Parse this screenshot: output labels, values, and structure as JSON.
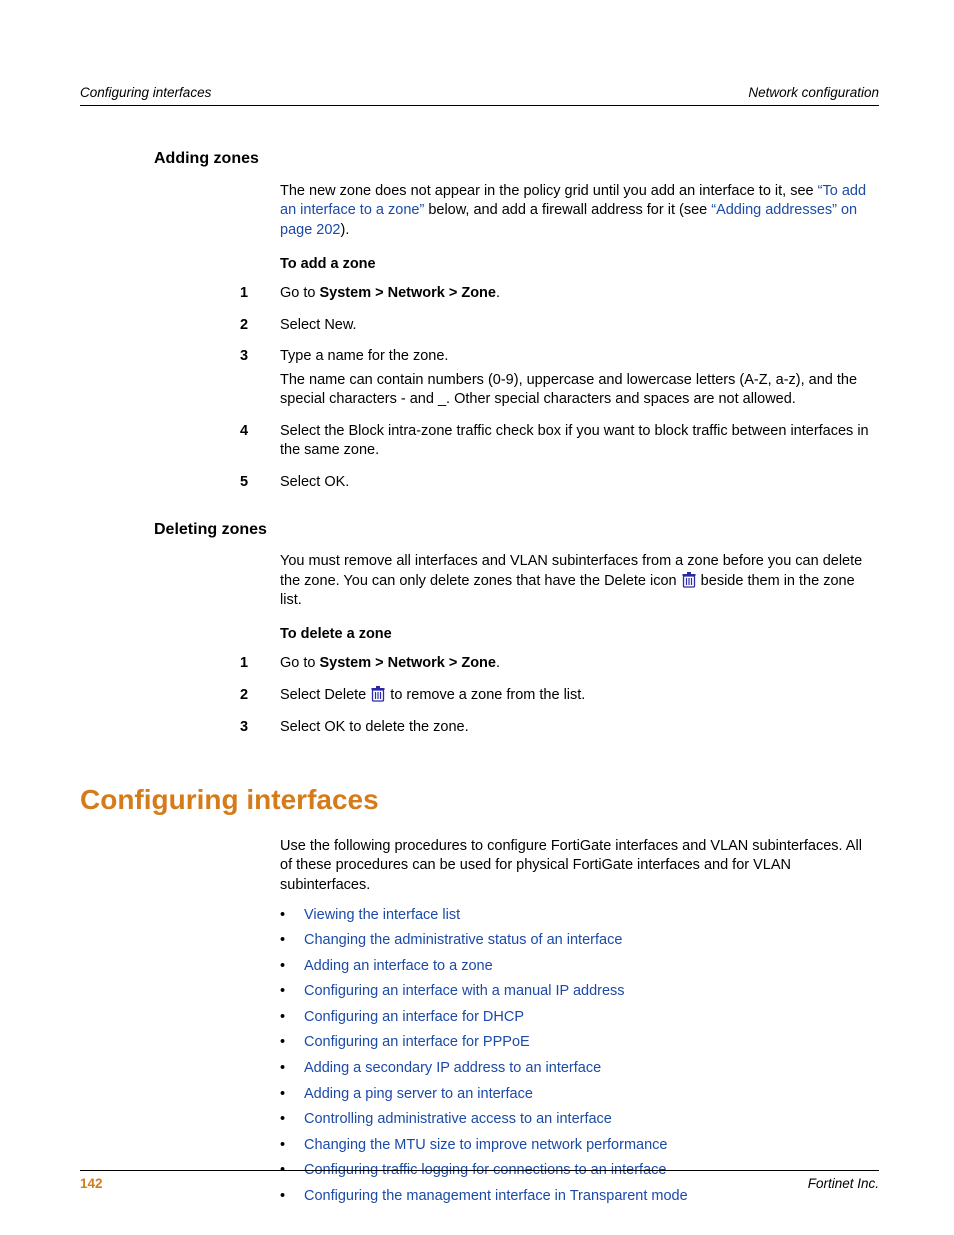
{
  "header": {
    "left": "Configuring interfaces",
    "right": "Network configuration"
  },
  "sections": {
    "addingZones": {
      "title": "Adding zones",
      "intro_pre": "The new zone does not appear in the policy grid until you add an interface to it, see ",
      "intro_link1": "“To add an interface to a zone”",
      "intro_mid": " below, and add a firewall address for it (see ",
      "intro_link2": "“Adding addresses” on page 202",
      "intro_post": ").",
      "procTitle": "To add a zone",
      "steps": [
        {
          "num": "1",
          "pre": "Go to ",
          "bold": "System > Network > Zone",
          "post": "."
        },
        {
          "num": "2",
          "text": "Select New."
        },
        {
          "num": "3",
          "text": "Type a name for the zone.",
          "extra": "The name can contain numbers (0-9), uppercase and lowercase letters (A-Z, a-z), and the special characters - and _. Other special characters and spaces are not allowed."
        },
        {
          "num": "4",
          "text": "Select the Block intra-zone traffic check box if you want to block traffic between interfaces in the same zone."
        },
        {
          "num": "5",
          "text": "Select OK."
        }
      ]
    },
    "deletingZones": {
      "title": "Deleting zones",
      "intro_pre": "You must remove all interfaces and VLAN subinterfaces from a zone before you can delete the zone. You can only delete zones that have the Delete icon ",
      "intro_post": " beside them in the zone list.",
      "procTitle": "To delete a zone",
      "steps": [
        {
          "num": "1",
          "pre": "Go to ",
          "bold": "System > Network > Zone",
          "post": "."
        },
        {
          "num": "2",
          "pre": "Select Delete ",
          "post": " to remove a zone from the list.",
          "hasIcon": true
        },
        {
          "num": "3",
          "text": "Select OK to delete the zone."
        }
      ]
    },
    "configuring": {
      "title": "Configuring interfaces",
      "intro": "Use the following procedures to configure FortiGate interfaces and VLAN subinterfaces. All of these procedures can be used for physical FortiGate interfaces and for VLAN subinterfaces.",
      "links": [
        "Viewing the interface list",
        "Changing the administrative status of an interface",
        "Adding an interface to a zone",
        "Configuring an interface with a manual IP address",
        "Configuring an interface for DHCP",
        "Configuring an interface for PPPoE",
        "Adding a secondary IP address to an interface",
        "Adding a ping server to an interface",
        "Controlling administrative access to an interface",
        "Changing the MTU size to improve network performance",
        "Configuring traffic logging for connections to an interface",
        "Configuring the management interface in Transparent mode"
      ]
    }
  },
  "footer": {
    "page": "142",
    "brand": "Fortinet Inc."
  },
  "bulletChar": "•"
}
